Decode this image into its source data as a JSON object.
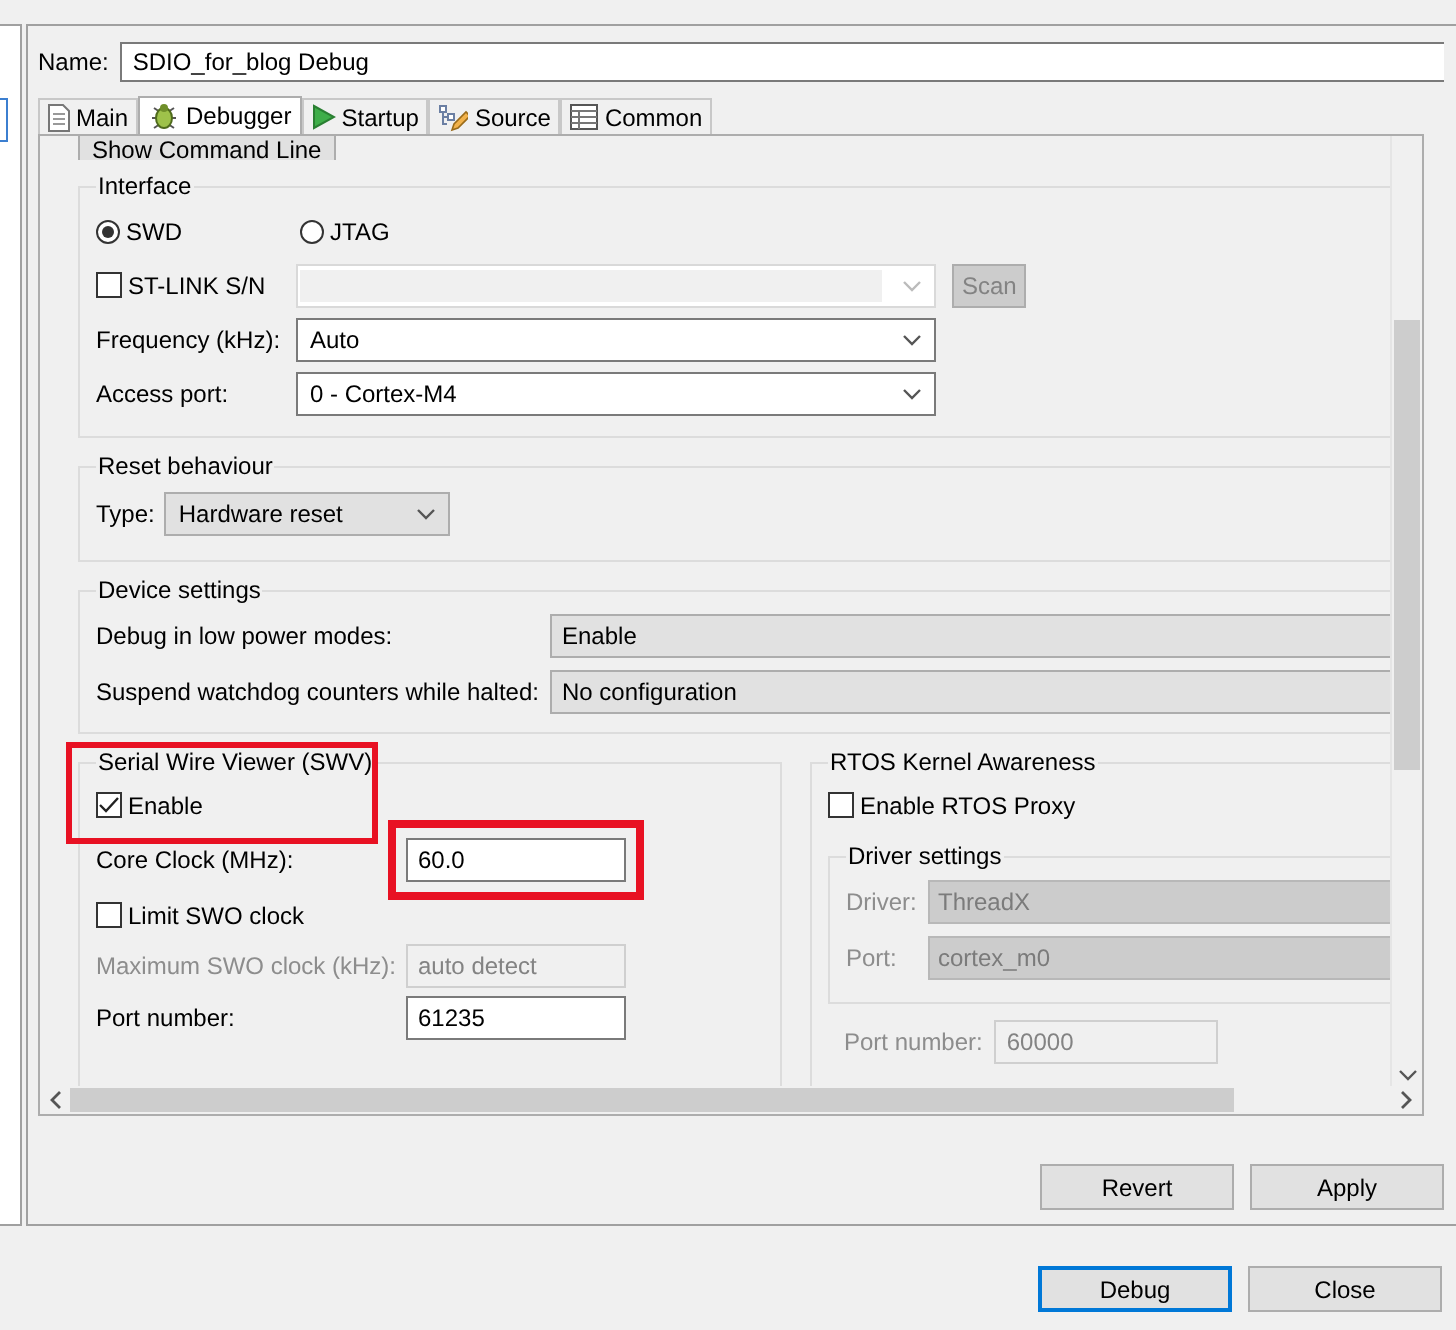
{
  "name_field": {
    "label": "Name:",
    "value": "SDIO_for_blog Debug"
  },
  "tabs": [
    {
      "label": "Main",
      "selected": false
    },
    {
      "label": "Debugger",
      "selected": true
    },
    {
      "label": "Startup",
      "selected": false
    },
    {
      "label": "Source",
      "selected": false
    },
    {
      "label": "Common",
      "selected": false
    }
  ],
  "show_command_line_button": "Show Command Line",
  "interface": {
    "title": "Interface",
    "options": [
      {
        "label": "SWD",
        "selected": true
      },
      {
        "label": "JTAG",
        "selected": false
      }
    ],
    "stlink": {
      "label": "ST-LINK S/N",
      "checked": false
    },
    "scan_button": {
      "label": "Scan",
      "disabled": true
    },
    "frequency": {
      "label": "Frequency (kHz):",
      "value": "Auto"
    },
    "access_port": {
      "label": "Access port:",
      "value": "0 - Cortex-M4"
    }
  },
  "reset_behaviour": {
    "title": "Reset behaviour",
    "type_label": "Type:",
    "type_value": "Hardware reset"
  },
  "device_settings": {
    "title": "Device settings",
    "rows": [
      {
        "label": "Debug in low power modes:",
        "value": "Enable"
      },
      {
        "label": "Suspend watchdog counters while halted:",
        "value": "No configuration"
      }
    ]
  },
  "swv": {
    "title": "Serial Wire Viewer (SWV)",
    "highlighted": true,
    "enable": {
      "label": "Enable",
      "checked": true
    },
    "core_clock": {
      "label": "Core Clock (MHz):",
      "value": "60.0",
      "highlighted": true
    },
    "limit_swo": {
      "label": "Limit SWO clock",
      "checked": false
    },
    "max_swo": {
      "label": "Maximum SWO clock (kHz):",
      "value": "auto detect",
      "disabled": true
    },
    "port": {
      "label": "Port number:",
      "value": "61235",
      "disabled": false
    }
  },
  "rtos": {
    "title": "RTOS Kernel Awareness",
    "enable": {
      "label": "Enable RTOS Proxy",
      "checked": false
    },
    "driver_settings": {
      "title": "Driver settings",
      "rows": [
        {
          "label": "Driver:",
          "value": "ThreadX",
          "disabled": true
        },
        {
          "label": "Port:",
          "value": "cortex_m0",
          "disabled": true
        }
      ]
    },
    "port": {
      "label": "Port number:",
      "value": "60000",
      "disabled": true
    }
  },
  "tab_buttons": [
    {
      "label": "Revert"
    },
    {
      "label": "Apply"
    }
  ],
  "dialog_buttons": [
    {
      "label": "Debug",
      "default": true
    },
    {
      "label": "Close",
      "default": false
    }
  ]
}
